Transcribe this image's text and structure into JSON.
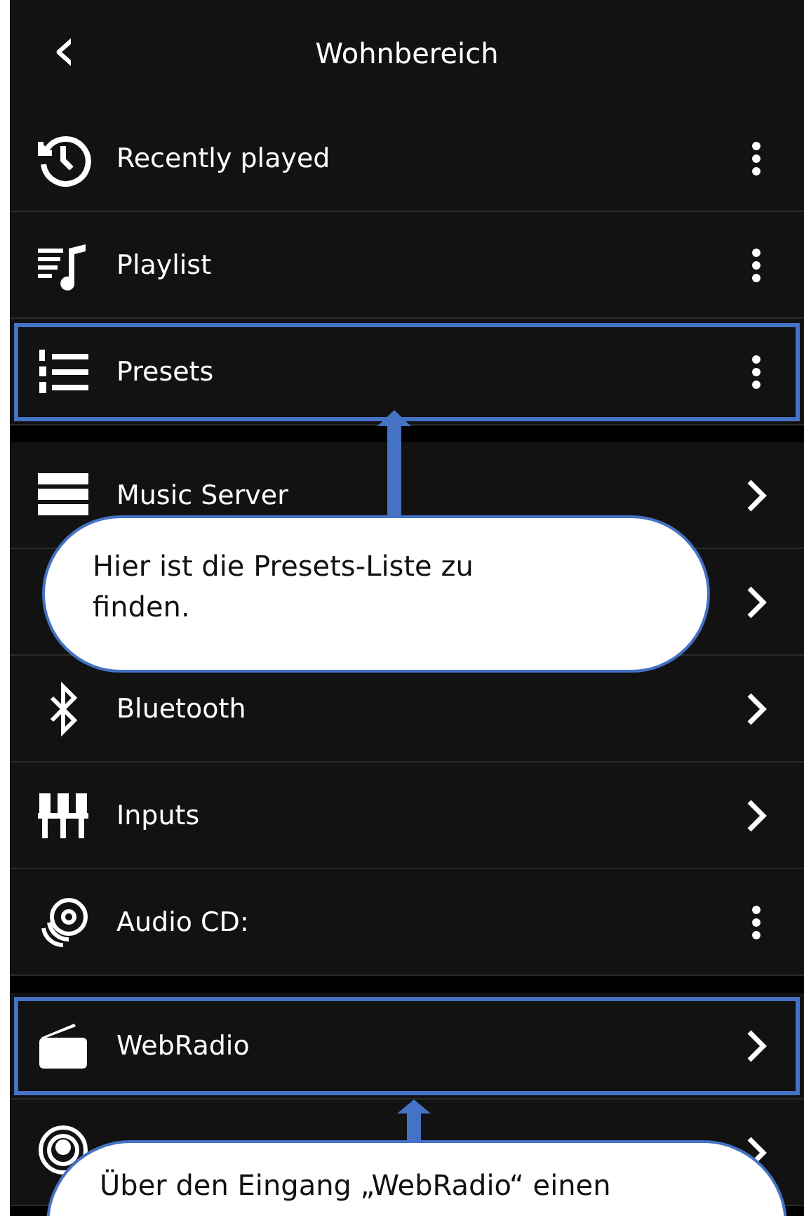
{
  "header": {
    "back": "‹",
    "title": "Wohnbereich"
  },
  "groups": [
    {
      "rows": [
        {
          "label": "Recently played",
          "kind": "more",
          "highlighted": false
        },
        {
          "label": "Playlist",
          "kind": "more",
          "highlighted": false
        },
        {
          "label": "Presets",
          "kind": "more",
          "highlighted": true
        }
      ]
    },
    {
      "rows": [
        {
          "label": "Music Server",
          "kind": "chevron",
          "highlighted": false
        },
        {
          "kind": "chevron",
          "highlighted": false
        },
        {
          "label": "Bluetooth",
          "kind": "chevron",
          "highlighted": false
        },
        {
          "label": "Inputs",
          "kind": "chevron",
          "highlighted": false
        },
        {
          "label": "Audio CD:",
          "kind": "more",
          "highlighted": false
        }
      ]
    },
    {
      "rows": [
        {
          "label": "WebRadio",
          "kind": "chevron",
          "highlighted": true
        },
        {
          "kind": "chevron",
          "highlighted": false
        }
      ]
    }
  ],
  "callouts": [
    {
      "text": "Hier ist die Presets-Liste zu finden."
    },
    {
      "text": "Über den Eingang „WebRadio“ einen"
    }
  ]
}
